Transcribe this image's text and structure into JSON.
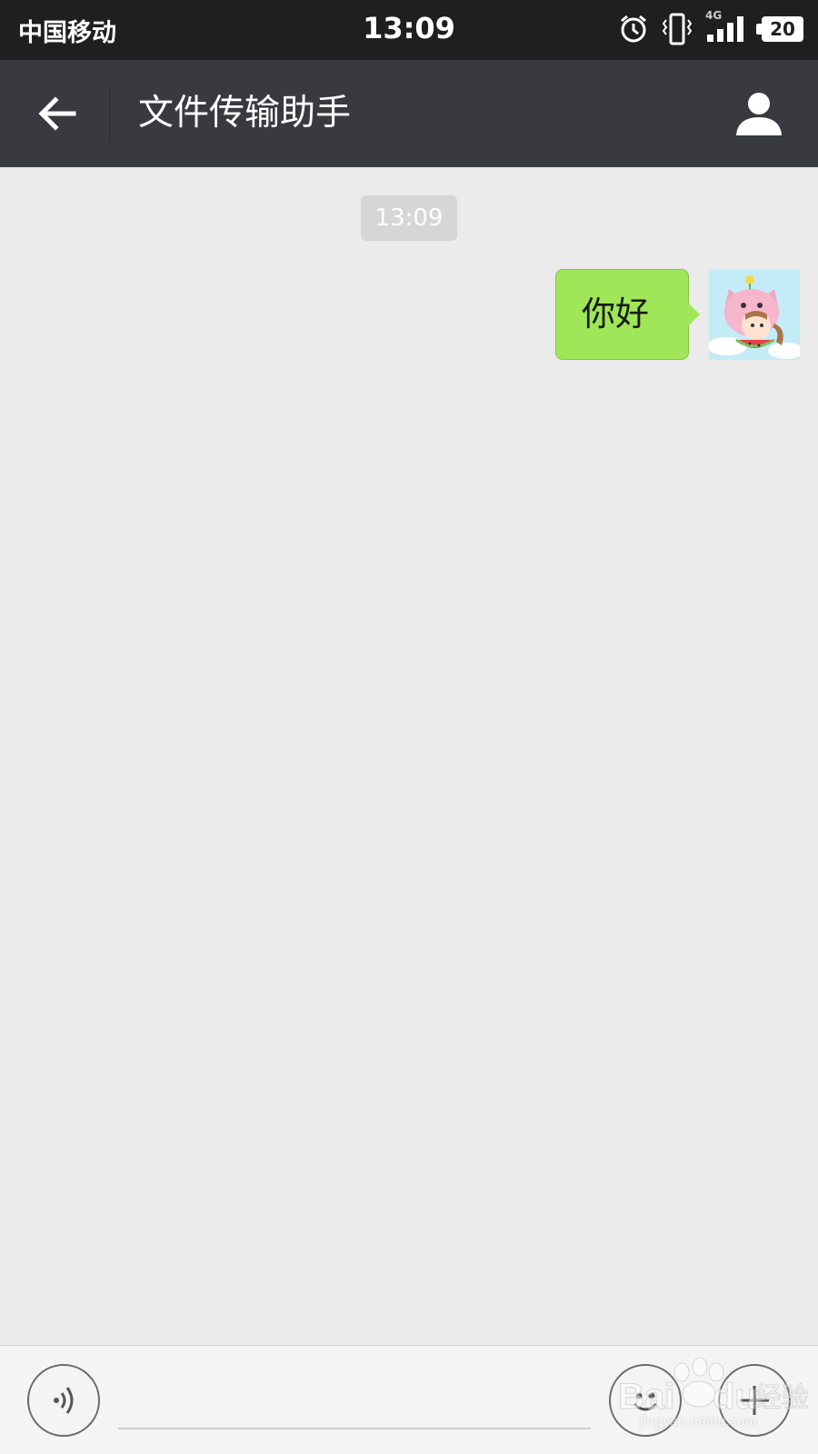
{
  "status_bar": {
    "carrier": "中国移动",
    "time": "13:09",
    "network": "4G",
    "battery": "20"
  },
  "nav": {
    "title": "文件传输助手"
  },
  "chat": {
    "timestamp": "13:09",
    "messages": [
      {
        "sender": "self",
        "text": "你好"
      }
    ]
  },
  "input_bar": {
    "placeholder": ""
  },
  "watermark": {
    "brand": "Baidu 经验",
    "url": "jingyan.baidu.com"
  },
  "colors": {
    "status_bar_bg": "#1f1f1f",
    "nav_bg": "#393a3f",
    "chat_bg": "#ebebeb",
    "bubble_green": "#9fe658",
    "input_bar_bg": "#f4f4f4"
  }
}
